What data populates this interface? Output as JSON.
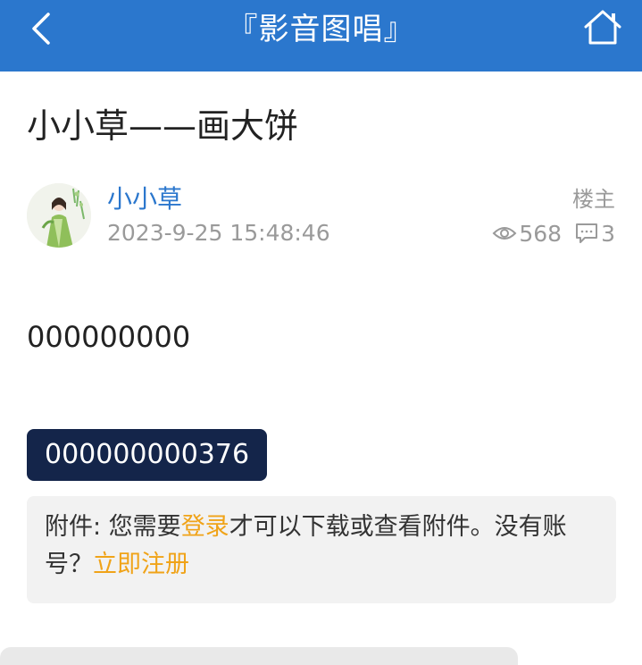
{
  "header": {
    "title": "『影音图唱』",
    "back_icon": "chevron-left-icon",
    "home_icon": "home-icon",
    "bg_color": "#2b77cd"
  },
  "post": {
    "title": "小小草——画大饼",
    "author": {
      "name": "小小草",
      "avatar_icon": "avatar-illustration"
    },
    "timestamp": "2023-9-25 15:48:46",
    "badge": "楼主",
    "views": "568",
    "replies": "3",
    "body_text": "000000000",
    "code_tag": "000000000376"
  },
  "attachment": {
    "prefix": "附件: 您需要",
    "login_link": "登录",
    "middle": "才可以下载或查看附件。没有账号？",
    "register_link": "立即注册"
  },
  "colors": {
    "link_blue": "#2b77cd",
    "link_orange": "#f0a318",
    "tag_bg": "#14254a",
    "muted": "#9a9a9a"
  }
}
